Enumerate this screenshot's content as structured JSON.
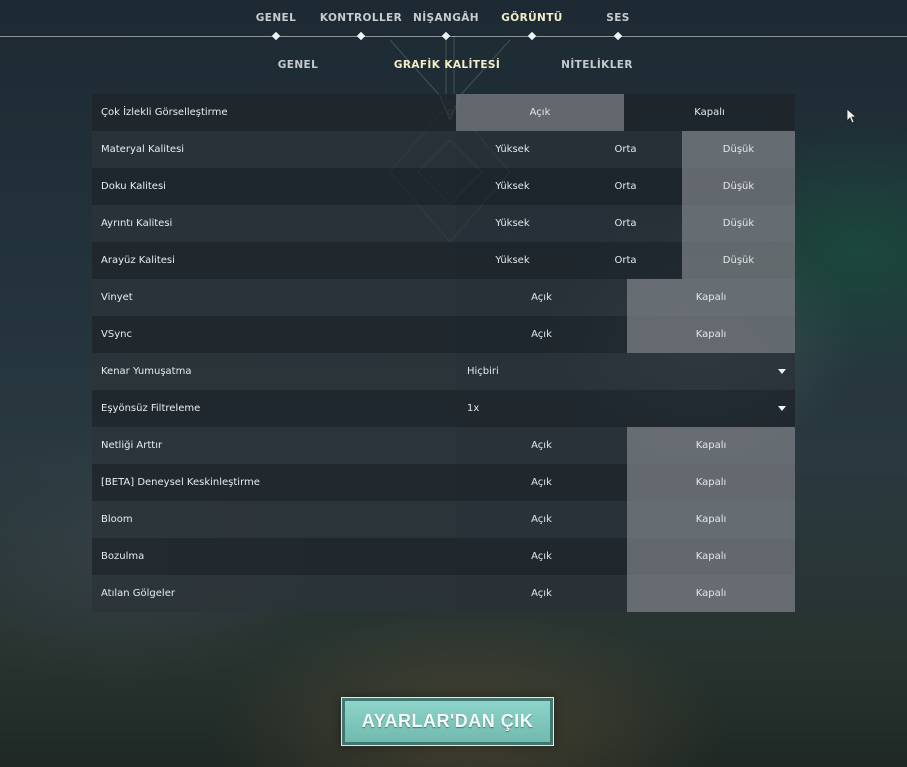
{
  "top_nav": {
    "tabs": [
      {
        "label": "GENEL",
        "active": false
      },
      {
        "label": "KONTROLLER",
        "active": false
      },
      {
        "label": "NİŞANGÂH",
        "active": false
      },
      {
        "label": "GÖRÜNTÜ",
        "active": true
      },
      {
        "label": "SES",
        "active": false
      }
    ]
  },
  "sub_nav": {
    "tabs": [
      {
        "label": "GENEL",
        "active": false
      },
      {
        "label": "GRAFİK KALİTESİ",
        "active": true
      },
      {
        "label": "NİTELİKLER",
        "active": false
      }
    ]
  },
  "settings": [
    {
      "label": "Çok İzlekli Görselleştirme",
      "type": "toggle",
      "options": [
        "Açık",
        "Kapalı"
      ],
      "selected": "Açık"
    },
    {
      "label": "Materyal Kalitesi",
      "type": "quality",
      "options": [
        "Yüksek",
        "Orta",
        "Düşük"
      ],
      "selected": "Düşük"
    },
    {
      "label": "Doku Kalitesi",
      "type": "quality",
      "options": [
        "Yüksek",
        "Orta",
        "Düşük"
      ],
      "selected": "Düşük"
    },
    {
      "label": "Ayrıntı Kalitesi",
      "type": "quality",
      "options": [
        "Yüksek",
        "Orta",
        "Düşük"
      ],
      "selected": "Düşük"
    },
    {
      "label": "Arayüz Kalitesi",
      "type": "quality",
      "options": [
        "Yüksek",
        "Orta",
        "Düşük"
      ],
      "selected": "Düşük"
    },
    {
      "label": "Vinyet",
      "type": "toggle",
      "options": [
        "Açık",
        "Kapalı"
      ],
      "selected": "Kapalı"
    },
    {
      "label": "VSync",
      "type": "toggle",
      "options": [
        "Açık",
        "Kapalı"
      ],
      "selected": "Kapalı"
    },
    {
      "label": "Kenar Yumuşatma",
      "type": "dropdown",
      "value": "Hiçbiri"
    },
    {
      "label": "Eşyönsüz Filtreleme",
      "type": "dropdown",
      "value": "1x"
    },
    {
      "label": "Netliği Arttır",
      "type": "toggle",
      "options": [
        "Açık",
        "Kapalı"
      ],
      "selected": "Kapalı"
    },
    {
      "label": "[BETA] Deneysel Keskinleştirme",
      "type": "toggle",
      "options": [
        "Açık",
        "Kapalı"
      ],
      "selected": "Kapalı"
    },
    {
      "label": "Bloom",
      "type": "toggle",
      "options": [
        "Açık",
        "Kapalı"
      ],
      "selected": "Kapalı"
    },
    {
      "label": "Bozulma",
      "type": "toggle",
      "options": [
        "Açık",
        "Kapalı"
      ],
      "selected": "Kapalı"
    },
    {
      "label": "Atılan Gölgeler",
      "type": "toggle",
      "options": [
        "Açık",
        "Kapalı"
      ],
      "selected": "Kapalı"
    }
  ],
  "footer": {
    "exit_label": "AYARLAR'DAN ÇIK"
  },
  "colors": {
    "active_tab": "#f4eec8",
    "selected_option": "#8c9196",
    "exit_button": "#7fc7bc"
  },
  "icons": {
    "emblem": "diamond-emblem-icon",
    "dropdown": "caret-down-icon",
    "cursor": "mouse-cursor-icon"
  }
}
